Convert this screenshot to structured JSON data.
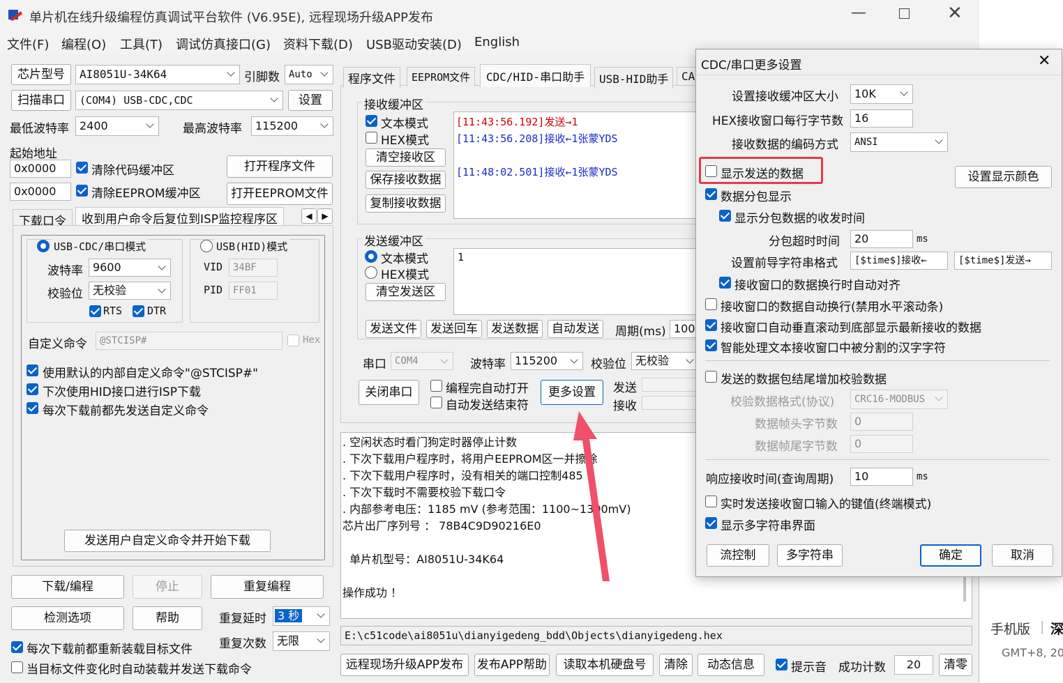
{
  "title": "单片机在线升级编程仿真调试平台软件 (V6.95E), 远程现场升级APP发布",
  "menu": [
    "文件(F)",
    "编程(O)",
    "工具(T)",
    "调试仿真接口(G)",
    "资料下载(D)",
    "USB驱动安装(D)",
    "English"
  ],
  "left": {
    "chip_label": "芯片型号",
    "chip_value": "AI8051U-34K64",
    "pin_label": "引脚数",
    "pin_value": "Auto",
    "scan_button": "扫描串口",
    "port_value": "(COM4) USB-CDC,CDC",
    "settings_button": "设置",
    "min_baud_label": "最低波特率",
    "min_baud_value": "2400",
    "max_baud_label": "最高波特率",
    "max_baud_value": "115200",
    "start_addr_label": "起始地址",
    "addr1": "0x0000",
    "clear_code": "清除代码缓冲区",
    "open_prog": "打开程序文件",
    "addr2": "0x0000",
    "clear_eeprom": "清除EEPROM缓冲区",
    "open_eeprom": "打开EEPROM文件",
    "tab1": "下载口令",
    "tab2": "收到用户命令后复位到ISP监控程序区",
    "cdc_mode": "USB-CDC/串口模式",
    "hid_mode": "USB(HID)模式",
    "baud_label": "波特率",
    "baud_value": "9600",
    "parity_label": "校验位",
    "parity_value": "无校验",
    "rts": "RTS",
    "dtr": "DTR",
    "vid_label": "VID",
    "vid_value": "34BF",
    "pid_label": "PID",
    "pid_value": "FF01",
    "custom_label": "自定义命令",
    "custom_value": "@STCISP#",
    "hex": "Hex",
    "opt1": "使用默认的内部自定义命令\"@STCISP#\"",
    "opt2": "下次使用HID接口进行ISP下载",
    "opt3": "每次下载前都先发送自定义命令",
    "send_custom_button": "发送用户自定义命令并开始下载",
    "download": "下载/编程",
    "stop": "停止",
    "reprogram": "重复编程",
    "detect": "检测选项",
    "help": "帮助",
    "delay_label": "重复延时",
    "delay_value": "3 秒",
    "count_label": "重复次数",
    "count_value": "无限",
    "reload": "每次下载前都重新装载目标文件",
    "auto_load": "当目标文件变化时自动装载并发送下载命令"
  },
  "tabs": [
    "程序文件",
    "EEPROM文件",
    "CDC/HID-串口助手",
    "USB-HID助手",
    "CA"
  ],
  "serial": {
    "recv_title": "接收缓冲区",
    "text_mode": "文本模式",
    "hex_mode": "HEX模式",
    "clear_recv": "清空接收区",
    "save_recv": "保存接收数据",
    "copy_recv": "复制接收数据",
    "recv_lines": [
      {
        "ts": "[11:43:56.192]",
        "msg": "发送→1",
        "color": "#d40000"
      },
      {
        "ts": "[11:43:56.208]",
        "msg": "接收←1张蒙YDS",
        "color": "#1a2ad0"
      },
      {
        "ts": "",
        "msg": "",
        "color": "#111"
      },
      {
        "ts": "[11:48:02.501]",
        "msg": "接收←1张蒙YDS",
        "color": "#1a2ad0"
      }
    ],
    "send_title": "发送缓冲区",
    "send_text": "1",
    "clear_send": "清空发送区",
    "send_file": "发送文件",
    "send_enter": "发送回车",
    "send_data": "发送数据",
    "auto_send": "自动发送",
    "period_label": "周期(ms)",
    "period_value": "100",
    "port_label": "串口",
    "port_value": "COM4",
    "baud_label": "波特率",
    "baud_value": "115200",
    "parity_label": "校验位",
    "parity_value": "无校验",
    "close_port": "关闭串口",
    "auto_open": "编程完自动打开",
    "auto_end": "自动发送结束符",
    "more_settings": "更多设置",
    "tx_label": "发送",
    "rx_label": "接收"
  },
  "log": [
    ". 空闲状态时看门狗定时器停止计数",
    ". 下次下载用户程序时，将用户EEPROM区一并擦除",
    ". 下次下载用户程序时，没有相关的端口控制485",
    ". 下次下载时不需要校验下载口令",
    ". 内部参考电压：1185 mV (参考范围：1100~1300mV)",
    "芯片出厂序列号 ： 78B4C9D90216E0",
    "",
    "  单片机型号：AI8051U-34K64",
    "",
    "操作成功 ！"
  ],
  "filepath": "E:\\c51code\\ai8051u\\dianyigedeng_bdd\\Objects\\dianyigedeng.hex",
  "bottom": {
    "remote": "远程现场升级APP发布",
    "app_help": "发布APP帮助",
    "read_disk": "读取本机硬盘号",
    "clear": "清除",
    "dynamic": "动态信息",
    "beep": "提示音",
    "success_label": "成功计数",
    "success_value": "20",
    "reset": "清零"
  },
  "right_edge": {
    "mobile": "手机版",
    "deep": "深",
    "gmt": "GMT+8, 20"
  },
  "dialog": {
    "title": "CDC/串口更多设置",
    "buf_size_label": "设置接收缓冲区大小",
    "buf_size_value": "10K",
    "hex_bytes_label": "HEX接收窗口每行字节数",
    "hex_bytes_value": "16",
    "encoding_label": "接收数据的编码方式",
    "encoding_value": "ANSI",
    "show_sent": "显示发送的数据",
    "set_color": "设置显示颜色",
    "packet_display": "数据分包显示",
    "packet_time": "显示分包数据的收发时间",
    "timeout_label": "分包超时时间",
    "timeout_value": "20",
    "ms": "ms",
    "prefix_label": "设置前导字符串格式",
    "prefix_recv": "[$time$]接收←",
    "prefix_send": "[$time$]发送→",
    "auto_align": "接收窗口的数据换行时自动对齐",
    "auto_wrap": "接收窗口的数据自动换行(禁用水平滚动条)",
    "auto_scroll": "接收窗口自动垂直滚动到底部显示最新接收的数据",
    "smart_cn": "智能处理文本接收窗口中被分割的汉字字符",
    "append_check": "发送的数据包结尾增加校验数据",
    "check_format_label": "校验数据格式(协议)",
    "check_format_value": "CRC16-MODBUS",
    "head_label": "数据帧头字节数",
    "head_value": "0",
    "tail_label": "数据帧尾字节数",
    "tail_value": "0",
    "resp_label": "响应接收时间(查询周期)",
    "resp_value": "10",
    "realtime": "实时发送接收窗口输入的键值(终端模式)",
    "multi_str": "显示多字符串界面",
    "flow": "流控制",
    "multi": "多字符串",
    "ok": "确定",
    "cancel": "取消"
  },
  "colors": {
    "accent": "#0a63c9",
    "highlight_box": "#e23b4e",
    "arrow": "#f0506a"
  }
}
